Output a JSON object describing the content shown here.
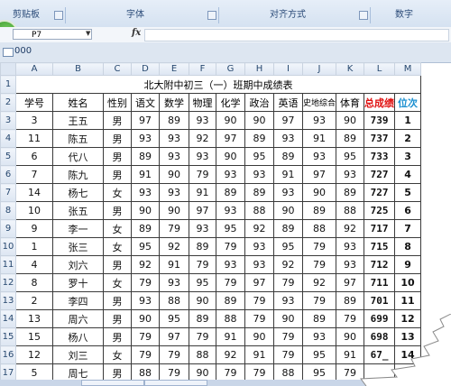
{
  "ribbon": {
    "groups": [
      {
        "label": "剪贴板"
      },
      {
        "label": "字体"
      },
      {
        "label": "对齐方式"
      },
      {
        "label": "数字"
      }
    ]
  },
  "formula_bar": {
    "name_box": "P7",
    "fx_label": "fx",
    "formula": ""
  },
  "tab_bar": {
    "label": "000"
  },
  "grid": {
    "columns": [
      "A",
      "B",
      "C",
      "D",
      "E",
      "F",
      "G",
      "H",
      "I",
      "J",
      "K",
      "L",
      "M"
    ],
    "rows": [
      "1",
      "2",
      "3",
      "4",
      "5",
      "6",
      "7",
      "8",
      "9",
      "10",
      "11",
      "12",
      "13",
      "14",
      "15",
      "16",
      "17"
    ],
    "title": "北大附中初三（一）班期中成绩表",
    "headers": [
      "学号",
      "姓名",
      "性别",
      "语文",
      "数学",
      "物理",
      "化学",
      "政治",
      "英语",
      "史地综合",
      "体育",
      "总成绩",
      "位次"
    ],
    "records": [
      [
        "3",
        "王五",
        "男",
        "97",
        "89",
        "93",
        "90",
        "90",
        "97",
        "93",
        "90",
        "739",
        "1"
      ],
      [
        "11",
        "陈五",
        "男",
        "93",
        "93",
        "92",
        "97",
        "89",
        "93",
        "91",
        "89",
        "737",
        "2"
      ],
      [
        "6",
        "代八",
        "男",
        "89",
        "93",
        "93",
        "90",
        "95",
        "89",
        "93",
        "95",
        "733",
        "3"
      ],
      [
        "7",
        "陈九",
        "男",
        "91",
        "90",
        "79",
        "93",
        "93",
        "91",
        "97",
        "93",
        "727",
        "4"
      ],
      [
        "14",
        "杨七",
        "女",
        "93",
        "93",
        "91",
        "89",
        "89",
        "93",
        "90",
        "89",
        "727",
        "5"
      ],
      [
        "10",
        "张五",
        "男",
        "90",
        "90",
        "97",
        "93",
        "88",
        "90",
        "89",
        "88",
        "725",
        "6"
      ],
      [
        "9",
        "李一",
        "女",
        "89",
        "79",
        "93",
        "95",
        "92",
        "89",
        "88",
        "92",
        "717",
        "7"
      ],
      [
        "1",
        "张三",
        "女",
        "95",
        "92",
        "89",
        "79",
        "93",
        "95",
        "79",
        "93",
        "715",
        "8"
      ],
      [
        "4",
        "刘六",
        "男",
        "92",
        "91",
        "79",
        "93",
        "93",
        "92",
        "79",
        "93",
        "712",
        "9"
      ],
      [
        "8",
        "罗十",
        "女",
        "79",
        "93",
        "95",
        "79",
        "97",
        "79",
        "92",
        "97",
        "711",
        "10"
      ],
      [
        "2",
        "李四",
        "男",
        "93",
        "88",
        "90",
        "89",
        "79",
        "93",
        "79",
        "89",
        "701",
        "11"
      ],
      [
        "13",
        "周六",
        "男",
        "90",
        "95",
        "89",
        "88",
        "79",
        "90",
        "89",
        "79",
        "699",
        "12"
      ],
      [
        "15",
        "杨八",
        "男",
        "79",
        "97",
        "79",
        "91",
        "90",
        "79",
        "93",
        "90",
        "698",
        "13"
      ],
      [
        "12",
        "刘三",
        "女",
        "79",
        "79",
        "88",
        "92",
        "91",
        "79",
        "95",
        "91",
        "67_",
        "14"
      ],
      [
        "5",
        "周七",
        "男",
        "88",
        "79",
        "90",
        "79",
        "79",
        "88",
        "95",
        "79",
        "",
        ""
      ]
    ]
  }
}
